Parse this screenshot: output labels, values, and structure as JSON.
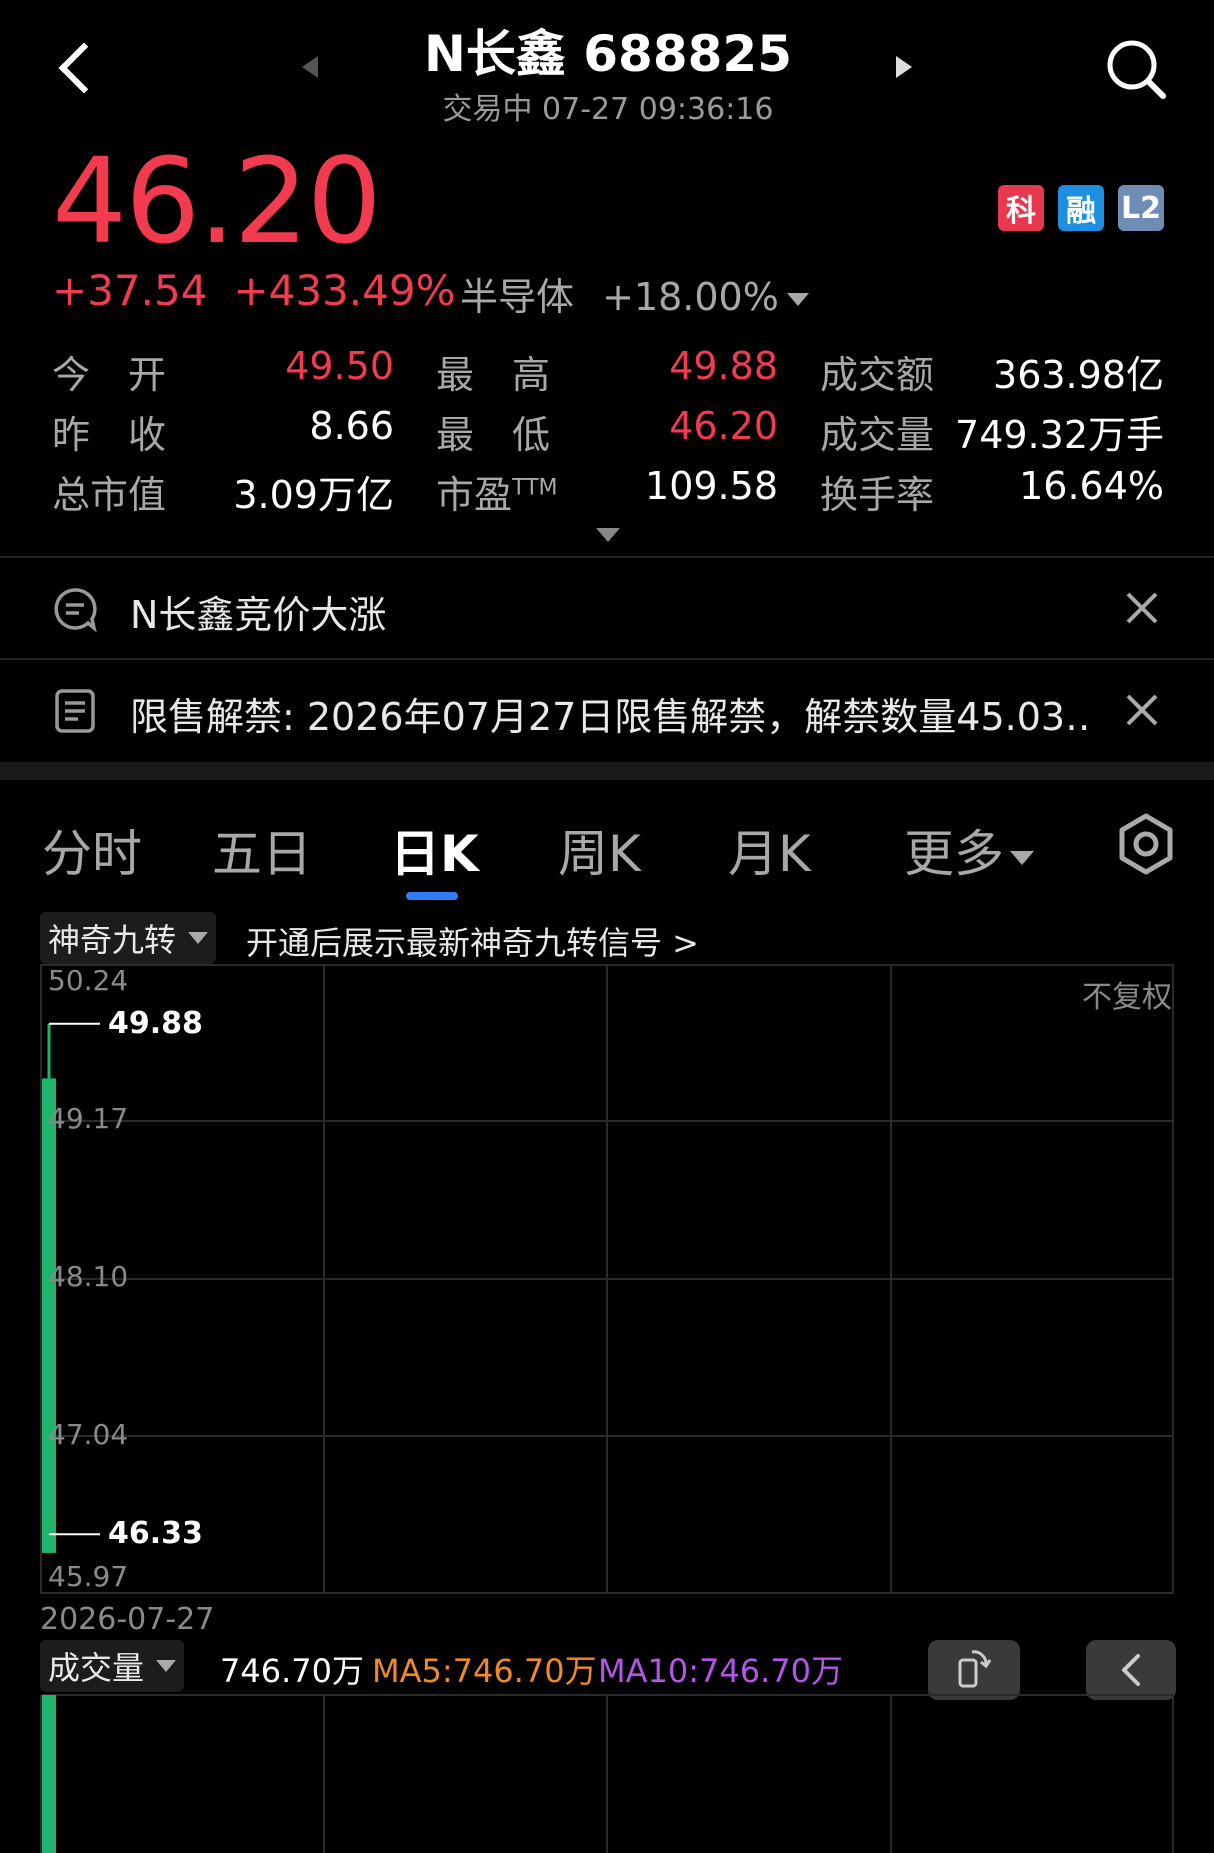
{
  "header": {
    "title": "N长鑫 688825",
    "subtitle": "交易中 07-27 09:36:16"
  },
  "quote": {
    "price": "46.20",
    "change": "+37.54",
    "change_pct": "+433.49%",
    "sector_name": "半导体",
    "sector_change": "+18.00%",
    "badges": [
      {
        "label": "科",
        "color": "#e8384f"
      },
      {
        "label": "融",
        "color": "#1e8fe0"
      },
      {
        "label": "L2",
        "color": "#6d8db5"
      }
    ]
  },
  "stats": {
    "open_label": "今　开",
    "open": "49.50",
    "high_label": "最　高",
    "high": "49.88",
    "amount_label": "成交额",
    "amount": "363.98亿",
    "prev_close_label": "昨　收",
    "prev_close": "8.66",
    "low_label": "最　低",
    "low": "46.20",
    "volume_label": "成交量",
    "volume": "749.32万手",
    "mcap_label": "总市值",
    "mcap": "3.09万亿",
    "pe_label": "市盈",
    "pe_sup": "TTM",
    "pe": "109.58",
    "turnover_label": "换手率",
    "turnover": "16.64%"
  },
  "notices": [
    {
      "text": "N长鑫竞价大涨"
    },
    {
      "text": "限售解禁: 2026年07月27日限售解禁，解禁数量45.03…"
    }
  ],
  "tabs": [
    "分时",
    "五日",
    "日K",
    "周K",
    "月K",
    "更多"
  ],
  "active_tab": "日K",
  "indicator": {
    "name": "神奇九转",
    "promo": "开通后展示最新神奇九转信号 >"
  },
  "chart": {
    "adjust_label": "不复权",
    "y_ticks": [
      "50.24",
      "49.17",
      "48.10",
      "47.04",
      "45.97"
    ],
    "high_marker": "49.88",
    "low_marker": "46.33",
    "date": "2026-07-27"
  },
  "chart_data": {
    "type": "bar",
    "x": [
      "2026-07-27"
    ],
    "candles": [
      {
        "date": "2026-07-27",
        "open": 49.5,
        "high": 49.88,
        "low": 46.2,
        "close": 46.2
      }
    ],
    "ylim": [
      45.97,
      50.24
    ],
    "title": "",
    "xlabel": "",
    "ylabel": ""
  },
  "volume": {
    "label": "成交量",
    "value": "746.70万",
    "ma5": "MA5:746.70万",
    "ma10": "MA10:746.70万",
    "ma5_color": "#f08a24",
    "ma10_color": "#b455e8"
  },
  "colors": {
    "up": "#f23b4f",
    "down": "#1fb36b",
    "accent": "#2f7cf6"
  }
}
